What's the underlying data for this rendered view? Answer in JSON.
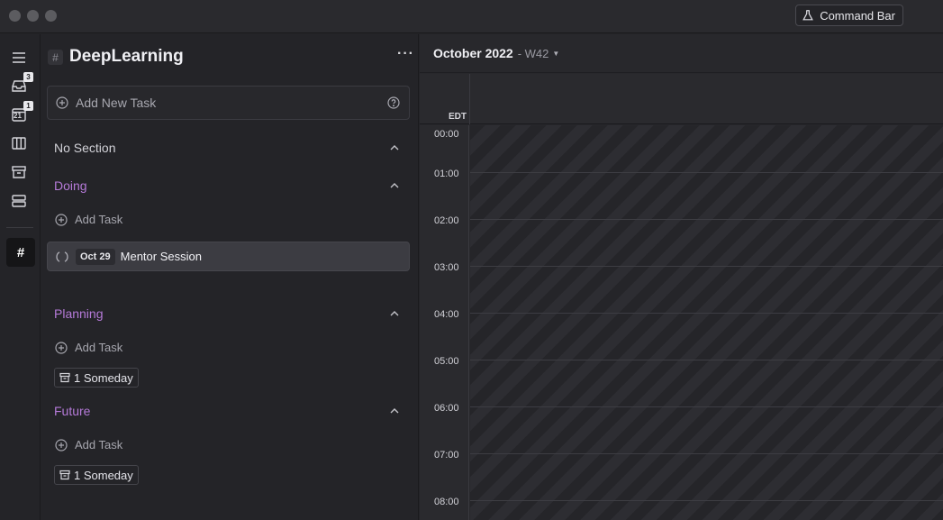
{
  "titlebar": {
    "command_bar_label": "Command Bar"
  },
  "rail": {
    "inbox_badge": "3",
    "calendar_badge": "1",
    "calendar_day": "21",
    "active_symbol": "#"
  },
  "project": {
    "symbol": "#",
    "title": "DeepLearning",
    "more": "···",
    "add_new_placeholder": "Add New Task"
  },
  "sections": [
    {
      "name": "No Section"
    },
    {
      "name": "Doing",
      "add_label": "Add Task"
    },
    {
      "name": "Planning",
      "add_label": "Add Task",
      "someday": "1 Someday"
    },
    {
      "name": "Future",
      "add_label": "Add Task",
      "someday": "1 Someday"
    }
  ],
  "task": {
    "date": "Oct 29",
    "title": "Mentor Session"
  },
  "calendar": {
    "month": "October 2022",
    "week": "- W42",
    "timezone": "EDT",
    "hours": [
      "00:00",
      "01:00",
      "02:00",
      "03:00",
      "04:00",
      "05:00",
      "06:00",
      "07:00",
      "08:00"
    ]
  },
  "colors": {
    "section_accent": "#b57ad8",
    "background": "#242428"
  }
}
